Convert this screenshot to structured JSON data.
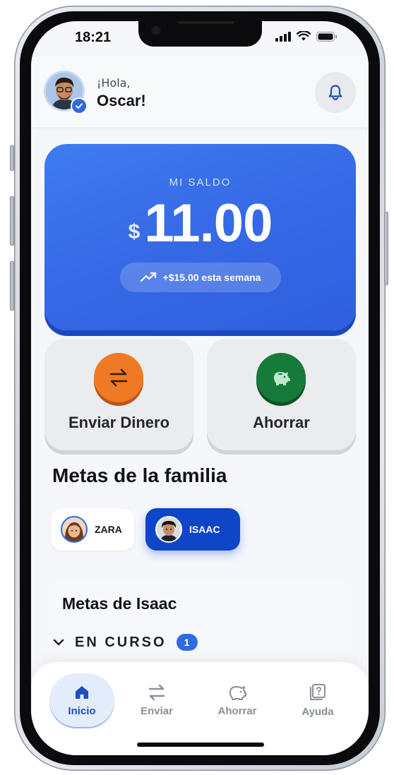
{
  "status_bar": {
    "time": "18:21"
  },
  "header": {
    "greeting": "¡Hola,",
    "name": "Oscar!"
  },
  "balance": {
    "label": "MI SALDO",
    "currency": "$",
    "amount": "11.00",
    "weekly_change": "+$15.00 esta semana"
  },
  "actions": [
    {
      "label": "Enviar Dinero",
      "icon": "arrows-swap-icon",
      "color": "#f07a24"
    },
    {
      "label": "Ahorrar",
      "icon": "piggy-bank-icon",
      "color": "#157a3a"
    }
  ],
  "family_goals": {
    "title": "Metas de la familia",
    "members": [
      {
        "name": "ZARA",
        "selected": false
      },
      {
        "name": "ISAAC",
        "selected": true
      }
    ]
  },
  "member_goals": {
    "title": "Metas de Isaac",
    "section": "EN CURSO",
    "count": "1"
  },
  "tabbar": {
    "tabs": [
      {
        "label": "Inicio",
        "icon": "home-icon",
        "active": true
      },
      {
        "label": "Enviar",
        "icon": "arrows-swap-icon",
        "active": false
      },
      {
        "label": "Ahorrar",
        "icon": "piggy-bank-icon",
        "active": false
      },
      {
        "label": "Ayuda",
        "icon": "help-icon",
        "active": false
      }
    ]
  },
  "colors": {
    "accent": "#2f6ae0",
    "card_blue": "#3669e6",
    "orange": "#f07a24",
    "green": "#157a3a"
  }
}
